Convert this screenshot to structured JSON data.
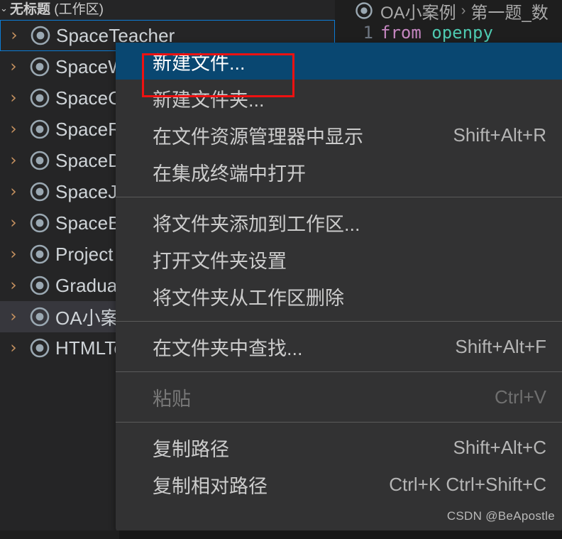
{
  "explorer": {
    "title_prefix": "无标题",
    "title_suffix": "(工作区)",
    "twisty_glyph": "›",
    "items": [
      {
        "label": "SpaceTeacher",
        "icon": "workspace-folder-icon",
        "state": "focused"
      },
      {
        "label": "SpaceWeb",
        "icon": "workspace-folder-icon",
        "state": "normal"
      },
      {
        "label": "SpaceCommon",
        "icon": "workspace-folder-icon",
        "state": "normal"
      },
      {
        "label": "SpaceResource",
        "icon": "workspace-folder-icon",
        "state": "normal"
      },
      {
        "label": "SpaceData",
        "icon": "workspace-folder-icon",
        "state": "normal"
      },
      {
        "label": "SpaceJudge",
        "icon": "workspace-folder-icon",
        "state": "normal"
      },
      {
        "label": "SpaceBase",
        "icon": "workspace-folder-icon",
        "state": "normal"
      },
      {
        "label": "Project",
        "icon": "workspace-folder-icon",
        "state": "normal"
      },
      {
        "label": "Graduate",
        "icon": "workspace-folder-icon",
        "state": "normal"
      },
      {
        "label": "OA小案例",
        "icon": "workspace-folder-icon",
        "state": "selected"
      },
      {
        "label": "HTMLTest",
        "icon": "workspace-folder-icon",
        "state": "normal"
      }
    ]
  },
  "editor": {
    "breadcrumb": {
      "root": "OA小案例",
      "separator": "›",
      "leaf": "第一题_数"
    },
    "code": {
      "line_number": "1",
      "keyword": "from",
      "module": "openpy"
    }
  },
  "context_menu": {
    "groups": [
      {
        "items": [
          {
            "label": "新建文件...",
            "shortcut": "",
            "state": "highlighted",
            "name": "menu-item-new-file"
          },
          {
            "label": "新建文件夹...",
            "shortcut": "",
            "state": "normal",
            "name": "menu-item-new-folder"
          },
          {
            "label": "在文件资源管理器中显示",
            "shortcut": "Shift+Alt+R",
            "state": "normal",
            "name": "menu-item-reveal-in-explorer"
          },
          {
            "label": "在集成终端中打开",
            "shortcut": "",
            "state": "normal",
            "name": "menu-item-open-in-terminal"
          }
        ]
      },
      {
        "items": [
          {
            "label": "将文件夹添加到工作区...",
            "shortcut": "",
            "state": "normal",
            "name": "menu-item-add-folder-to-workspace"
          },
          {
            "label": "打开文件夹设置",
            "shortcut": "",
            "state": "normal",
            "name": "menu-item-open-folder-settings"
          },
          {
            "label": "将文件夹从工作区删除",
            "shortcut": "",
            "state": "normal",
            "name": "menu-item-remove-folder-from-workspace"
          }
        ]
      },
      {
        "items": [
          {
            "label": "在文件夹中查找...",
            "shortcut": "Shift+Alt+F",
            "state": "normal",
            "name": "menu-item-find-in-folder"
          }
        ]
      },
      {
        "items": [
          {
            "label": "粘贴",
            "shortcut": "Ctrl+V",
            "state": "disabled",
            "name": "menu-item-paste"
          }
        ]
      },
      {
        "items": [
          {
            "label": "复制路径",
            "shortcut": "Shift+Alt+C",
            "state": "normal",
            "name": "menu-item-copy-path"
          },
          {
            "label": "复制相对路径",
            "shortcut": "Ctrl+K Ctrl+Shift+C",
            "state": "normal",
            "name": "menu-item-copy-relative-path"
          }
        ]
      }
    ]
  },
  "watermark": {
    "text": "CSDN @BeApostle"
  },
  "colors": {
    "menu_background": "#323233",
    "menu_highlight": "#094771",
    "highlight_outline": "#ee1111",
    "focus_border": "#0c7cd5",
    "tree_selected": "#37373d",
    "sidebar_background": "#252526",
    "editor_background": "#1e1e1e"
  }
}
